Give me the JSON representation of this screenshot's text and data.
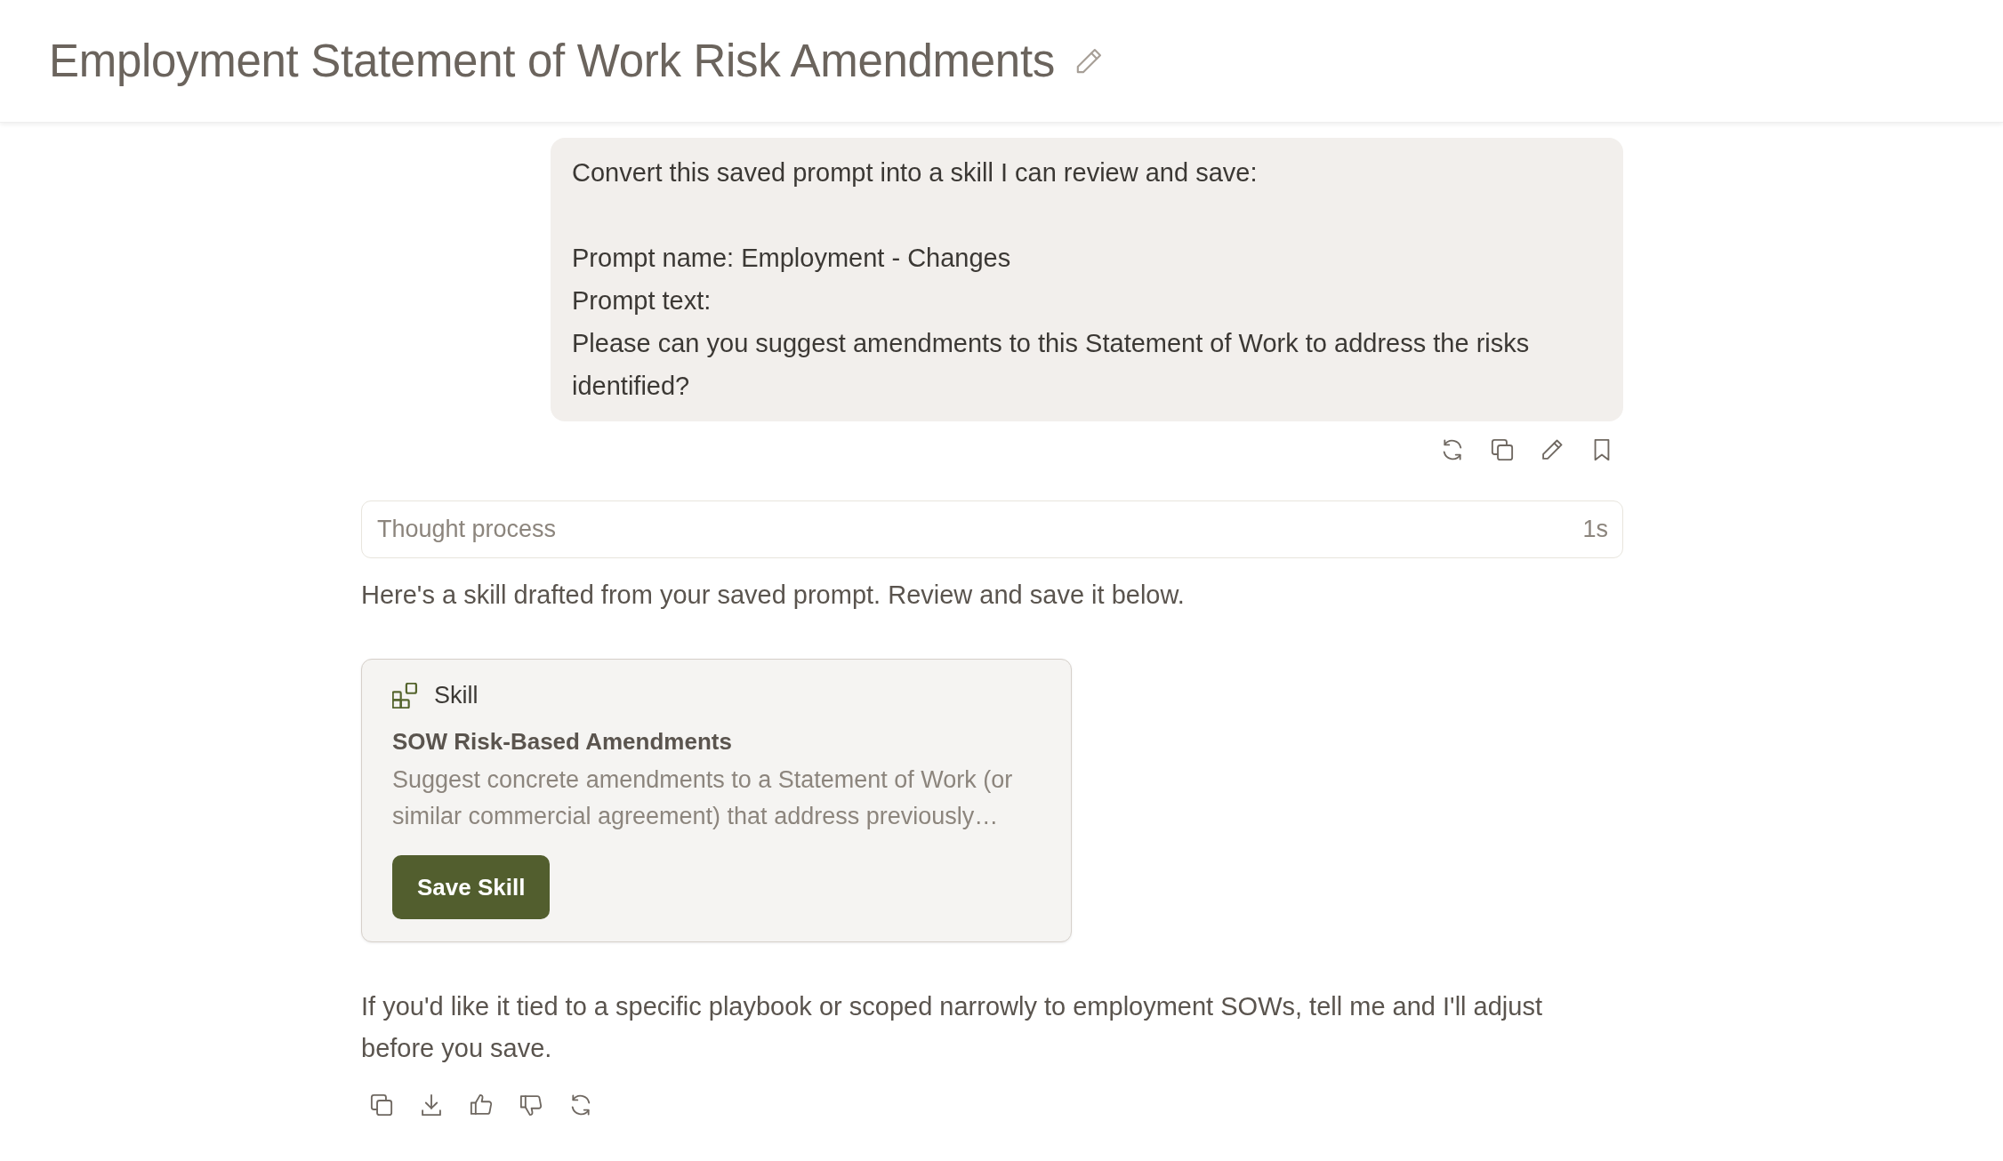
{
  "header": {
    "title": "Employment Statement of Work Risk Amendments"
  },
  "user_message": {
    "text": "Convert this saved prompt into a skill I can review and save:\n\nPrompt name: Employment - Changes\nPrompt text:\nPlease can you suggest amendments to this Statement of Work to address the risks identified?"
  },
  "thought_process": {
    "label": "Thought process",
    "duration": "1s"
  },
  "response": {
    "intro": "Here's a skill drafted from your saved prompt. Review and save it below.",
    "skill_card": {
      "type_label": "Skill",
      "name": "SOW Risk-Based Amendments",
      "description": "Suggest concrete amendments to a Statement of Work (or similar commercial agreement) that address previously…",
      "button": "Save Skill"
    },
    "closing": "If you'd like it tied to a specific playbook or scoped narrowly to employment SOWs, tell me and I'll adjust before you save."
  }
}
